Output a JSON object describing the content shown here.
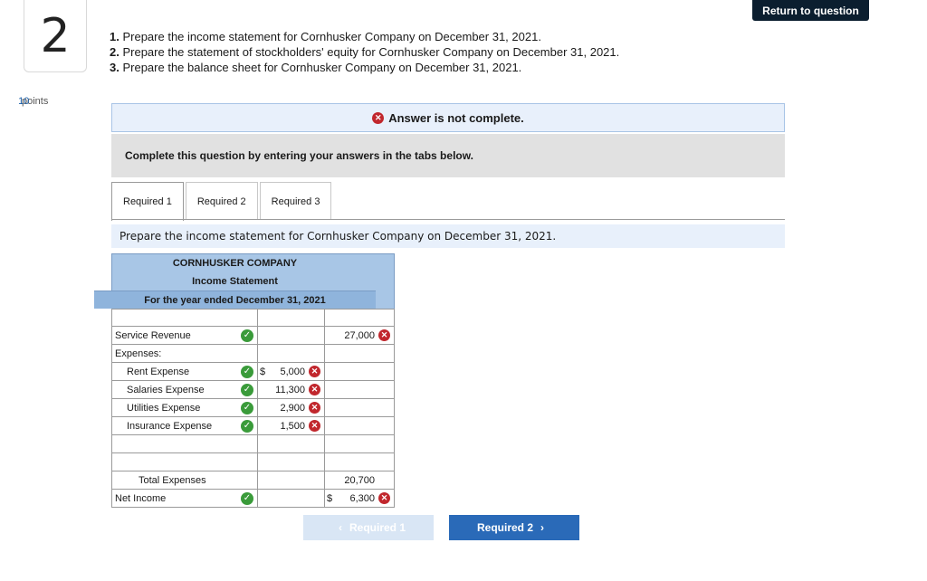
{
  "question": {
    "number": "2",
    "points_value": "10",
    "points_label": "points"
  },
  "return_button": "Return to question",
  "instructions": [
    {
      "n": "1.",
      "text": "Prepare the income statement for Cornhusker Company on December 31, 2021."
    },
    {
      "n": "2.",
      "text": "Prepare the statement of stockholders' equity for Cornhusker Company on December 31, 2021."
    },
    {
      "n": "3.",
      "text": "Prepare the balance sheet for Cornhusker Company on December 31, 2021."
    }
  ],
  "status_message": "Answer is not complete.",
  "complete_message": "Complete this question by entering your answers in the tabs below.",
  "tabs": [
    "Required 1",
    "Required 2",
    "Required 3"
  ],
  "prompt": "Prepare the income statement for Cornhusker Company on December 31, 2021.",
  "statement": {
    "company": "CORNHUSKER COMPANY",
    "title": "Income Statement",
    "period": "For the year ended December 31, 2021",
    "rows": {
      "service_revenue": {
        "label": "Service Revenue",
        "c3": "27,000"
      },
      "expenses": {
        "label": "Expenses:"
      },
      "rent": {
        "label": "Rent Expense",
        "sym": "$",
        "c2": "5,000"
      },
      "salaries": {
        "label": "Salaries Expense",
        "c2": "11,300"
      },
      "utilities": {
        "label": "Utilities Expense",
        "c2": "2,900"
      },
      "insurance": {
        "label": "Insurance Expense",
        "c2": "1,500"
      },
      "total": {
        "label": "Total Expenses",
        "c3": "20,700"
      },
      "net_income": {
        "label": "Net Income",
        "sym": "$",
        "c3": "6,300"
      }
    }
  },
  "nav": {
    "prev": "Required 1",
    "next": "Required 2"
  },
  "colors": {
    "check": "#3a9b3a",
    "error": "#c1272d",
    "header_blue": "#a8c6e6",
    "nav_blue": "#2a6ab8"
  }
}
